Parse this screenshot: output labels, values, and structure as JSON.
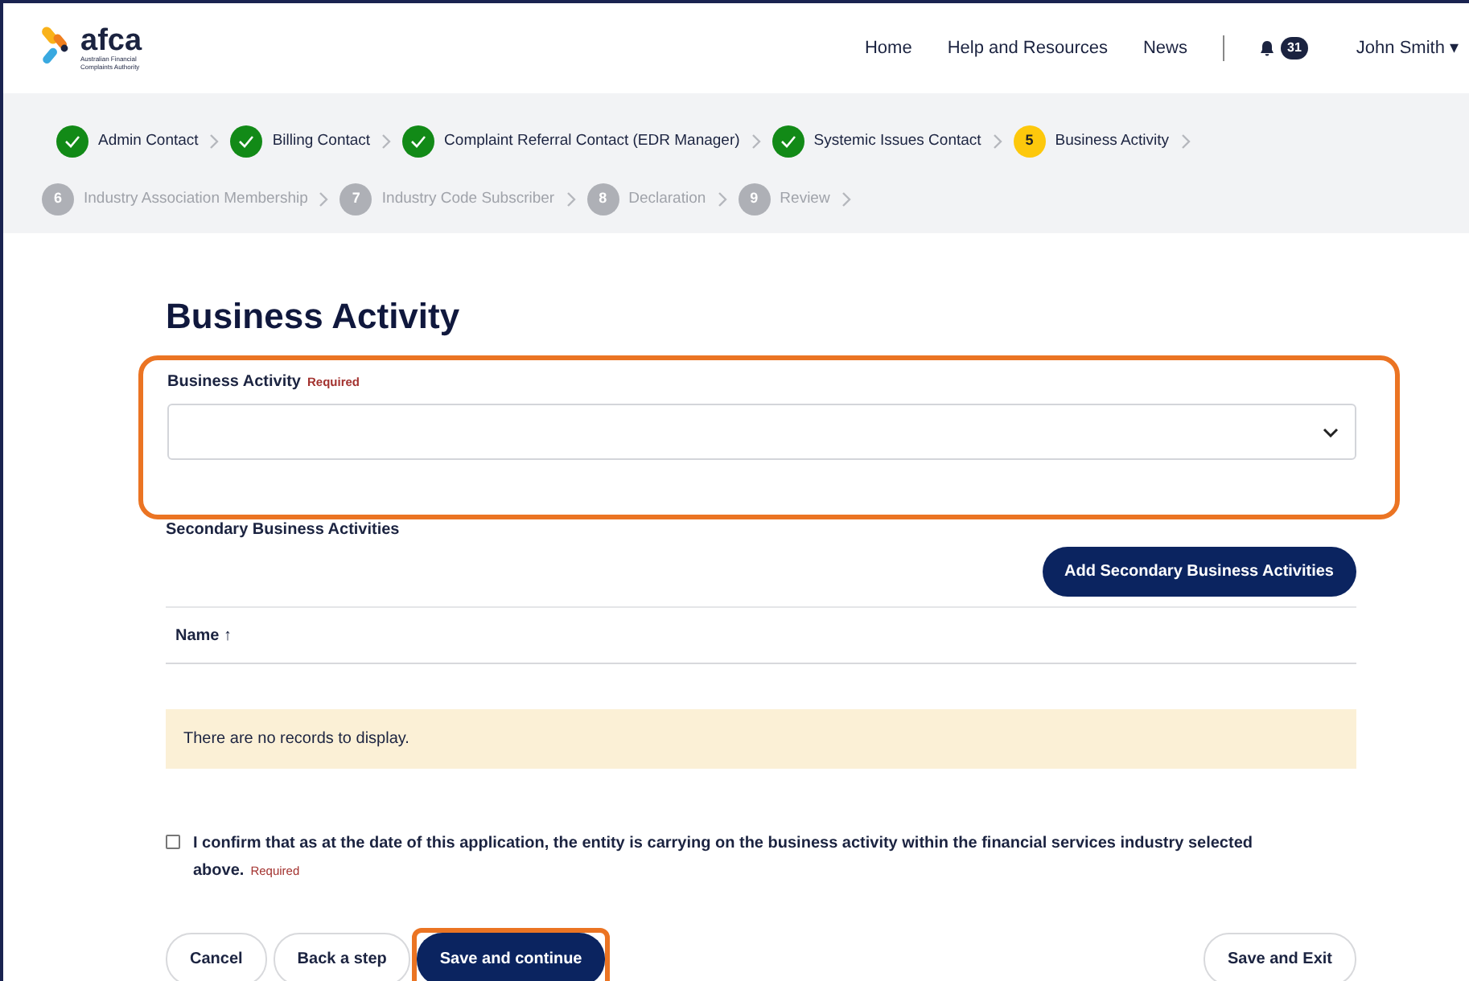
{
  "header": {
    "logo": {
      "wordmark": "afca",
      "tagline": "Australian Financial Complaints Authority"
    },
    "nav": [
      "Home",
      "Help and Resources",
      "News"
    ],
    "notifications": {
      "count": "31"
    },
    "user": {
      "name": "John Smith",
      "caret": "▾"
    }
  },
  "steps": [
    {
      "label": "Admin Contact",
      "kind": "done"
    },
    {
      "label": "Billing Contact",
      "kind": "done"
    },
    {
      "label": "Complaint Referral Contact (EDR Manager)",
      "kind": "done"
    },
    {
      "label": "Systemic Issues Contact",
      "kind": "done"
    },
    {
      "label": "Business Activity",
      "kind": "current",
      "number": "5"
    },
    {
      "label": "Industry Association Membership",
      "kind": "upcoming",
      "number": "6"
    },
    {
      "label": "Industry Code Subscriber",
      "kind": "upcoming",
      "number": "7"
    },
    {
      "label": "Declaration",
      "kind": "upcoming",
      "number": "8"
    },
    {
      "label": "Review",
      "kind": "upcoming",
      "number": "9"
    }
  ],
  "page_title": "Business Activity",
  "business_activity_field": {
    "label": "Business Activity",
    "required": "Required",
    "highlighted": true
  },
  "secondary": {
    "label": "Secondary Business Activities",
    "add_button": "Add Secondary Business Activities",
    "table": {
      "columns": [
        {
          "label": "Name",
          "sort": "↑"
        }
      ],
      "empty_message": "There are no records to display."
    }
  },
  "confirmation": {
    "text": "I confirm that as at the date of this application, the entity is carrying on the business activity within the financial services industry selected above.",
    "required": "Required",
    "checked": false
  },
  "buttons": [
    {
      "label": "Cancel",
      "kind": "outline",
      "highlighted": false
    },
    {
      "label": "Back a step",
      "kind": "outline",
      "highlighted": false
    },
    {
      "label": "Save and continue",
      "kind": "primary",
      "highlighted": true
    },
    {
      "label": "Save and Exit",
      "kind": "outline-right",
      "highlighted": false
    }
  ]
}
